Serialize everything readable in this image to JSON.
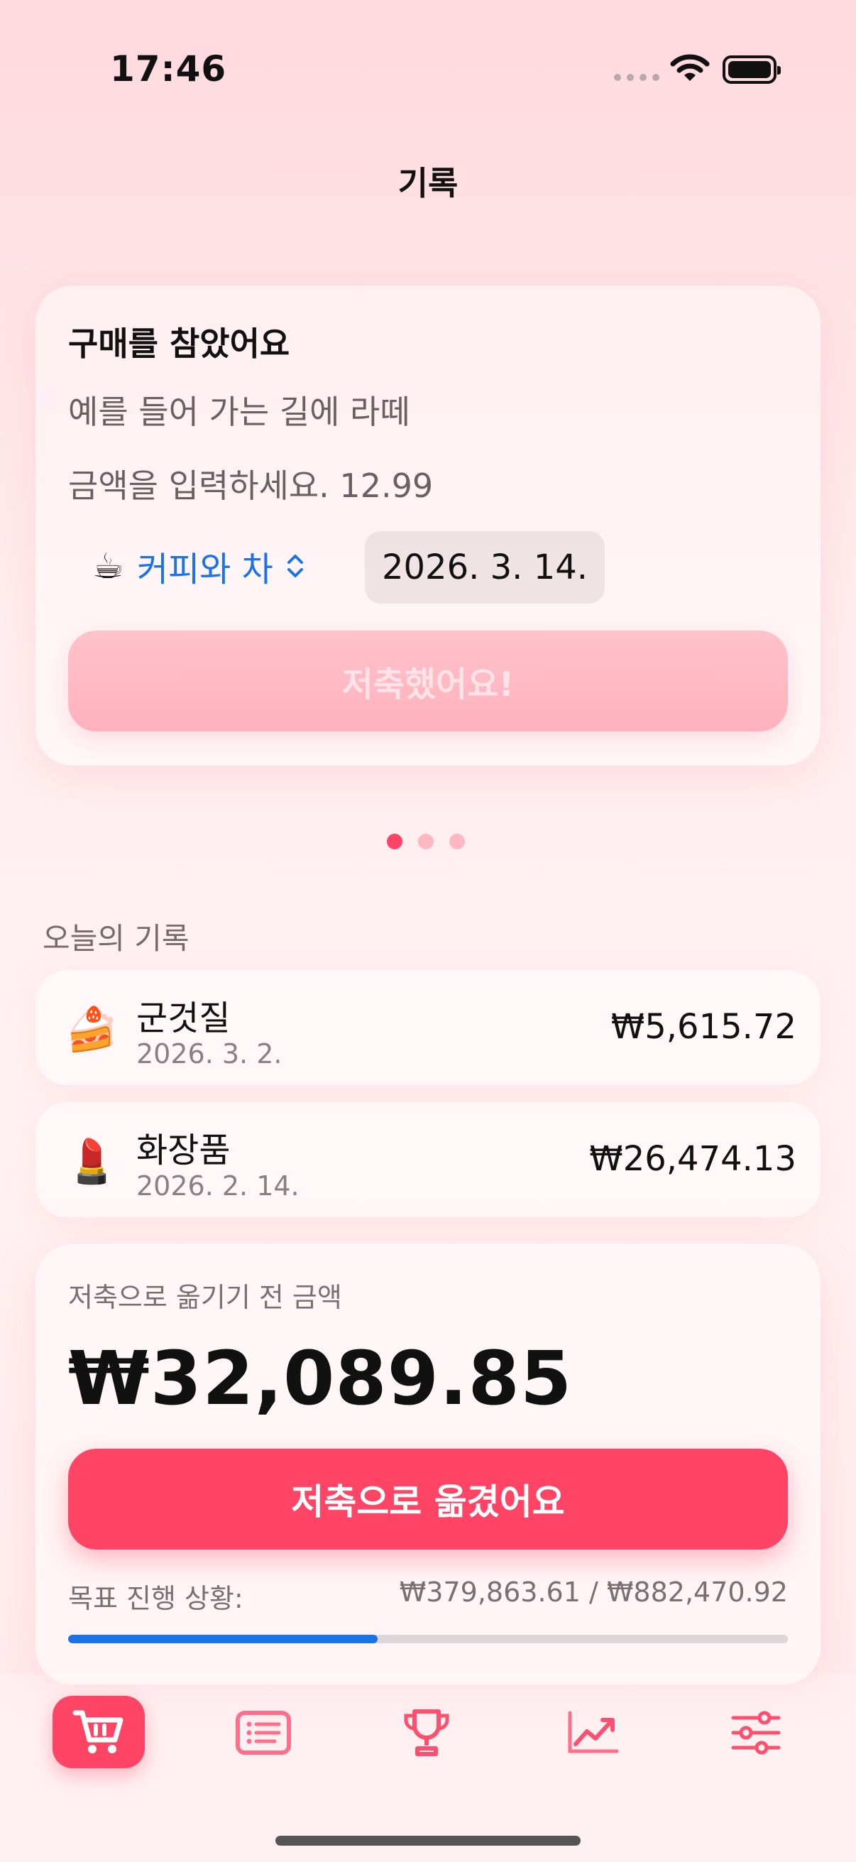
{
  "status_bar": {
    "time": "17:46"
  },
  "nav": {
    "title": "기록"
  },
  "entry_card": {
    "title": "구매를 참았어요",
    "description_placeholder": "예를 들어 가는 길에 라떼",
    "amount_placeholder": "금액을 입력하세요. 12.99",
    "category": {
      "emoji": "☕",
      "label": "커피와 차",
      "chevron": "⌃⌄"
    },
    "date": "2026. 3. 14.",
    "save_label": "저축했어요!"
  },
  "pager": {
    "count": 3,
    "active_index": 0
  },
  "today_section": {
    "label": "오늘의 기록",
    "items": [
      {
        "emoji": "🍰",
        "name": "군것질",
        "date": "2026. 3. 2.",
        "amount": "₩5,615.72"
      },
      {
        "emoji": "💄",
        "name": "화장품",
        "date": "2026. 2. 14.",
        "amount": "₩26,474.13"
      }
    ]
  },
  "summary": {
    "label": "저축으로 옮기기 전 금액",
    "total": "₩32,089.85",
    "move_label": "저축으로 옮겼어요",
    "goal_label": "목표 진행 상황:",
    "goal_values": "₩379,863.61 / ₩882,470.92",
    "goal_progress": 0.43
  },
  "tabs": [
    {
      "icon": "cart-icon",
      "active": true
    },
    {
      "icon": "list-icon",
      "active": false
    },
    {
      "icon": "trophy-icon",
      "active": false
    },
    {
      "icon": "chart-icon",
      "active": false
    },
    {
      "icon": "sliders-icon",
      "active": false
    }
  ],
  "colors": {
    "accent": "#ff4466",
    "accent_light": "#ffb2bd",
    "link_blue": "#1a73e8",
    "dot_inactive": "#ffb8c3"
  }
}
